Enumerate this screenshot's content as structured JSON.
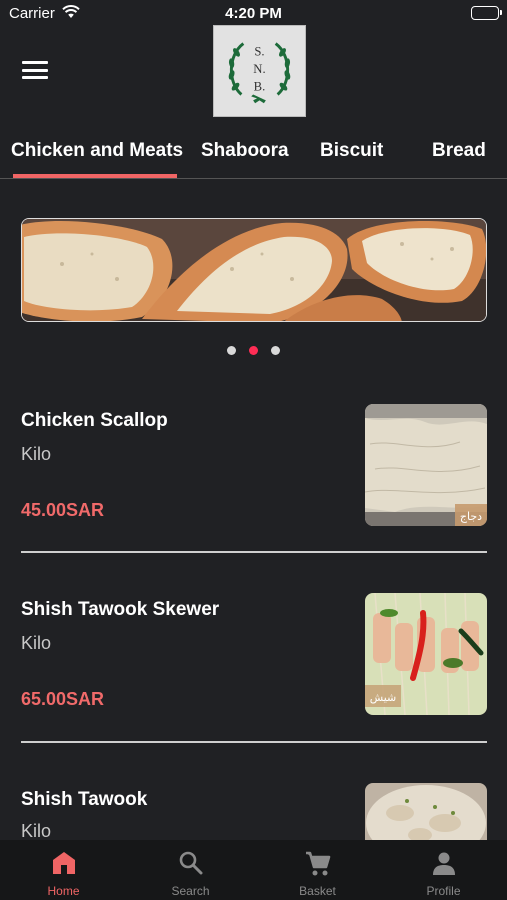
{
  "status_bar": {
    "carrier": "Carrier",
    "time": "4:20 PM"
  },
  "header": {
    "menu_icon": "hamburger-menu-icon",
    "logo_text": [
      "S.",
      "N.",
      "B."
    ]
  },
  "tabs": [
    {
      "label": "Chicken and Meats",
      "selected": true
    },
    {
      "label": "Shaboora",
      "selected": false
    },
    {
      "label": "Biscuit",
      "selected": false
    },
    {
      "label": "Bread",
      "selected": false
    }
  ],
  "carousel": {
    "page_count": 3,
    "active_index": 1
  },
  "products": [
    {
      "name": "Chicken Scallop",
      "unit": "Kilo",
      "price": "45.00SAR",
      "image_caption": "دجاج"
    },
    {
      "name": "Shish Tawook Skewer",
      "unit": "Kilo",
      "price": "65.00SAR",
      "image_caption": "شيش"
    },
    {
      "name": "Shish Tawook",
      "unit": "Kilo",
      "price": "",
      "image_caption": ""
    }
  ],
  "bottom_nav": [
    {
      "label": "Home",
      "icon": "home-icon",
      "active": true
    },
    {
      "label": "Search",
      "icon": "search-icon",
      "active": false
    },
    {
      "label": "Basket",
      "icon": "cart-icon",
      "active": false
    },
    {
      "label": "Profile",
      "icon": "person-icon",
      "active": false
    }
  ],
  "colors": {
    "accent": "#f06565",
    "background": "#202124",
    "active_dot": "#ff2d55"
  }
}
